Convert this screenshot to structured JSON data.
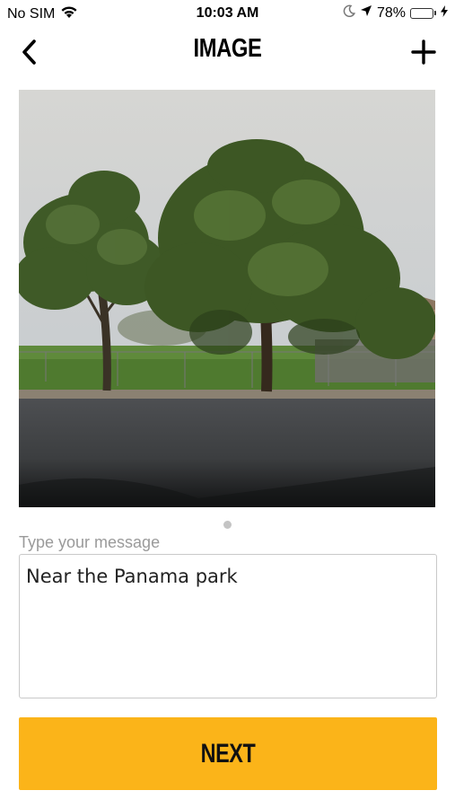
{
  "status_bar": {
    "carrier": "No SIM",
    "time": "10:03 AM",
    "battery_percent": "78%",
    "battery_level": 0.78,
    "icons": [
      "wifi-icon",
      "moon-icon",
      "location-arrow-icon",
      "battery-icon",
      "charging-bolt-icon"
    ]
  },
  "nav": {
    "title": "IMAGE",
    "back_icon": "chevron-left-icon",
    "add_icon": "plus-icon"
  },
  "photo": {
    "subject": "street-with-trees-photo"
  },
  "message": {
    "label": "Type your message",
    "value": "Near the Panama park"
  },
  "next_button": {
    "label": "NEXT",
    "color": "#fbb419"
  }
}
